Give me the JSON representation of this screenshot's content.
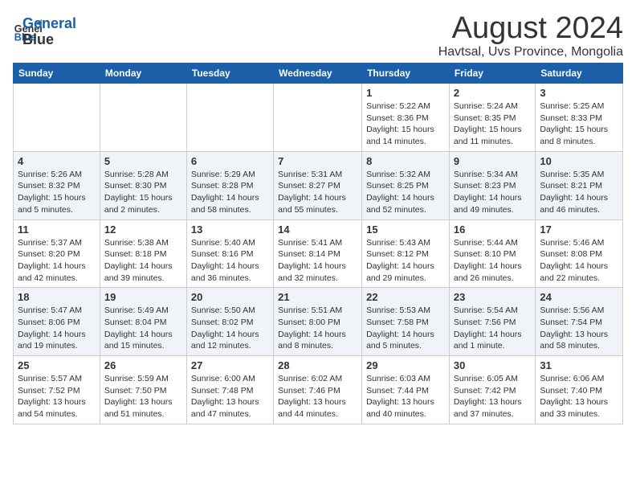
{
  "logo": {
    "line1": "General",
    "line2": "Blue"
  },
  "title": "August 2024",
  "subtitle": "Havtsal, Uvs Province, Mongolia",
  "days_of_week": [
    "Sunday",
    "Monday",
    "Tuesday",
    "Wednesday",
    "Thursday",
    "Friday",
    "Saturday"
  ],
  "weeks": [
    [
      {
        "day": "",
        "info": ""
      },
      {
        "day": "",
        "info": ""
      },
      {
        "day": "",
        "info": ""
      },
      {
        "day": "",
        "info": ""
      },
      {
        "day": "1",
        "info": "Sunrise: 5:22 AM\nSunset: 8:36 PM\nDaylight: 15 hours\nand 14 minutes."
      },
      {
        "day": "2",
        "info": "Sunrise: 5:24 AM\nSunset: 8:35 PM\nDaylight: 15 hours\nand 11 minutes."
      },
      {
        "day": "3",
        "info": "Sunrise: 5:25 AM\nSunset: 8:33 PM\nDaylight: 15 hours\nand 8 minutes."
      }
    ],
    [
      {
        "day": "4",
        "info": "Sunrise: 5:26 AM\nSunset: 8:32 PM\nDaylight: 15 hours\nand 5 minutes."
      },
      {
        "day": "5",
        "info": "Sunrise: 5:28 AM\nSunset: 8:30 PM\nDaylight: 15 hours\nand 2 minutes."
      },
      {
        "day": "6",
        "info": "Sunrise: 5:29 AM\nSunset: 8:28 PM\nDaylight: 14 hours\nand 58 minutes."
      },
      {
        "day": "7",
        "info": "Sunrise: 5:31 AM\nSunset: 8:27 PM\nDaylight: 14 hours\nand 55 minutes."
      },
      {
        "day": "8",
        "info": "Sunrise: 5:32 AM\nSunset: 8:25 PM\nDaylight: 14 hours\nand 52 minutes."
      },
      {
        "day": "9",
        "info": "Sunrise: 5:34 AM\nSunset: 8:23 PM\nDaylight: 14 hours\nand 49 minutes."
      },
      {
        "day": "10",
        "info": "Sunrise: 5:35 AM\nSunset: 8:21 PM\nDaylight: 14 hours\nand 46 minutes."
      }
    ],
    [
      {
        "day": "11",
        "info": "Sunrise: 5:37 AM\nSunset: 8:20 PM\nDaylight: 14 hours\nand 42 minutes."
      },
      {
        "day": "12",
        "info": "Sunrise: 5:38 AM\nSunset: 8:18 PM\nDaylight: 14 hours\nand 39 minutes."
      },
      {
        "day": "13",
        "info": "Sunrise: 5:40 AM\nSunset: 8:16 PM\nDaylight: 14 hours\nand 36 minutes."
      },
      {
        "day": "14",
        "info": "Sunrise: 5:41 AM\nSunset: 8:14 PM\nDaylight: 14 hours\nand 32 minutes."
      },
      {
        "day": "15",
        "info": "Sunrise: 5:43 AM\nSunset: 8:12 PM\nDaylight: 14 hours\nand 29 minutes."
      },
      {
        "day": "16",
        "info": "Sunrise: 5:44 AM\nSunset: 8:10 PM\nDaylight: 14 hours\nand 26 minutes."
      },
      {
        "day": "17",
        "info": "Sunrise: 5:46 AM\nSunset: 8:08 PM\nDaylight: 14 hours\nand 22 minutes."
      }
    ],
    [
      {
        "day": "18",
        "info": "Sunrise: 5:47 AM\nSunset: 8:06 PM\nDaylight: 14 hours\nand 19 minutes."
      },
      {
        "day": "19",
        "info": "Sunrise: 5:49 AM\nSunset: 8:04 PM\nDaylight: 14 hours\nand 15 minutes."
      },
      {
        "day": "20",
        "info": "Sunrise: 5:50 AM\nSunset: 8:02 PM\nDaylight: 14 hours\nand 12 minutes."
      },
      {
        "day": "21",
        "info": "Sunrise: 5:51 AM\nSunset: 8:00 PM\nDaylight: 14 hours\nand 8 minutes."
      },
      {
        "day": "22",
        "info": "Sunrise: 5:53 AM\nSunset: 7:58 PM\nDaylight: 14 hours\nand 5 minutes."
      },
      {
        "day": "23",
        "info": "Sunrise: 5:54 AM\nSunset: 7:56 PM\nDaylight: 14 hours\nand 1 minute."
      },
      {
        "day": "24",
        "info": "Sunrise: 5:56 AM\nSunset: 7:54 PM\nDaylight: 13 hours\nand 58 minutes."
      }
    ],
    [
      {
        "day": "25",
        "info": "Sunrise: 5:57 AM\nSunset: 7:52 PM\nDaylight: 13 hours\nand 54 minutes."
      },
      {
        "day": "26",
        "info": "Sunrise: 5:59 AM\nSunset: 7:50 PM\nDaylight: 13 hours\nand 51 minutes."
      },
      {
        "day": "27",
        "info": "Sunrise: 6:00 AM\nSunset: 7:48 PM\nDaylight: 13 hours\nand 47 minutes."
      },
      {
        "day": "28",
        "info": "Sunrise: 6:02 AM\nSunset: 7:46 PM\nDaylight: 13 hours\nand 44 minutes."
      },
      {
        "day": "29",
        "info": "Sunrise: 6:03 AM\nSunset: 7:44 PM\nDaylight: 13 hours\nand 40 minutes."
      },
      {
        "day": "30",
        "info": "Sunrise: 6:05 AM\nSunset: 7:42 PM\nDaylight: 13 hours\nand 37 minutes."
      },
      {
        "day": "31",
        "info": "Sunrise: 6:06 AM\nSunset: 7:40 PM\nDaylight: 13 hours\nand 33 minutes."
      }
    ]
  ]
}
